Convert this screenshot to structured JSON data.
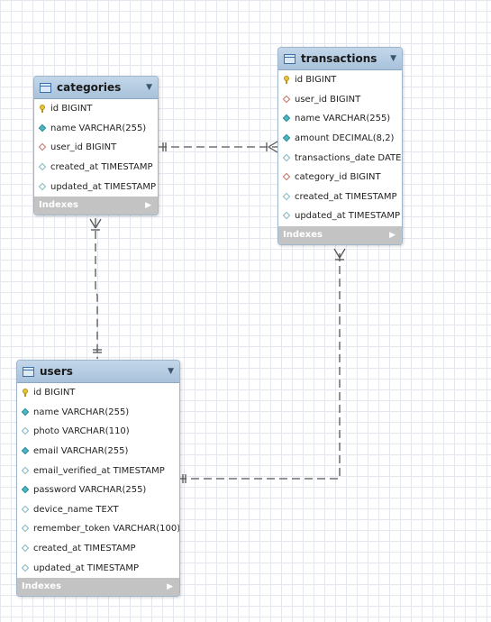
{
  "entities": {
    "categories": {
      "title": "categories",
      "columns": [
        {
          "label": "id BIGINT",
          "icon": "primary-key-icon"
        },
        {
          "label": "name VARCHAR(255)",
          "icon": "not-null-column-icon"
        },
        {
          "label": "user_id BIGINT",
          "icon": "foreign-key-icon"
        },
        {
          "label": "created_at TIMESTAMP",
          "icon": "nullable-column-icon"
        },
        {
          "label": "updated_at TIMESTAMP",
          "icon": "nullable-column-icon"
        }
      ],
      "indexes_label": "Indexes"
    },
    "transactions": {
      "title": "transactions",
      "columns": [
        {
          "label": "id BIGINT",
          "icon": "primary-key-icon"
        },
        {
          "label": "user_id BIGINT",
          "icon": "foreign-key-icon"
        },
        {
          "label": "name VARCHAR(255)",
          "icon": "not-null-column-icon"
        },
        {
          "label": "amount DECIMAL(8,2)",
          "icon": "not-null-column-icon"
        },
        {
          "label": "transactions_date DATE",
          "icon": "nullable-column-icon"
        },
        {
          "label": "category_id BIGINT",
          "icon": "foreign-key-icon"
        },
        {
          "label": "created_at TIMESTAMP",
          "icon": "nullable-column-icon"
        },
        {
          "label": "updated_at TIMESTAMP",
          "icon": "nullable-column-icon"
        }
      ],
      "indexes_label": "Indexes"
    },
    "users": {
      "title": "users",
      "columns": [
        {
          "label": "id BIGINT",
          "icon": "primary-key-icon"
        },
        {
          "label": "name VARCHAR(255)",
          "icon": "not-null-column-icon"
        },
        {
          "label": "photo VARCHAR(110)",
          "icon": "nullable-column-icon"
        },
        {
          "label": "email VARCHAR(255)",
          "icon": "not-null-column-icon"
        },
        {
          "label": "email_verified_at TIMESTAMP",
          "icon": "nullable-column-icon"
        },
        {
          "label": "password VARCHAR(255)",
          "icon": "not-null-column-icon"
        },
        {
          "label": "device_name TEXT",
          "icon": "nullable-column-icon"
        },
        {
          "label": "remember_token VARCHAR(100)",
          "icon": "nullable-column-icon"
        },
        {
          "label": "created_at TIMESTAMP",
          "icon": "nullable-column-icon"
        },
        {
          "label": "updated_at TIMESTAMP",
          "icon": "nullable-column-icon"
        }
      ],
      "indexes_label": "Indexes"
    }
  },
  "relationships": [
    {
      "from": "categories",
      "to": "transactions",
      "from_end": "one",
      "to_end": "many"
    },
    {
      "from": "users",
      "to": "categories",
      "from_end": "one",
      "to_end": "many"
    },
    {
      "from": "users",
      "to": "transactions",
      "from_end": "one",
      "to_end": "many"
    }
  ],
  "colors": {
    "header": "#a8c2db",
    "indexes_bar": "#c3c3c3",
    "grid": "#e4e8ee",
    "relationship_line": "#555555"
  }
}
